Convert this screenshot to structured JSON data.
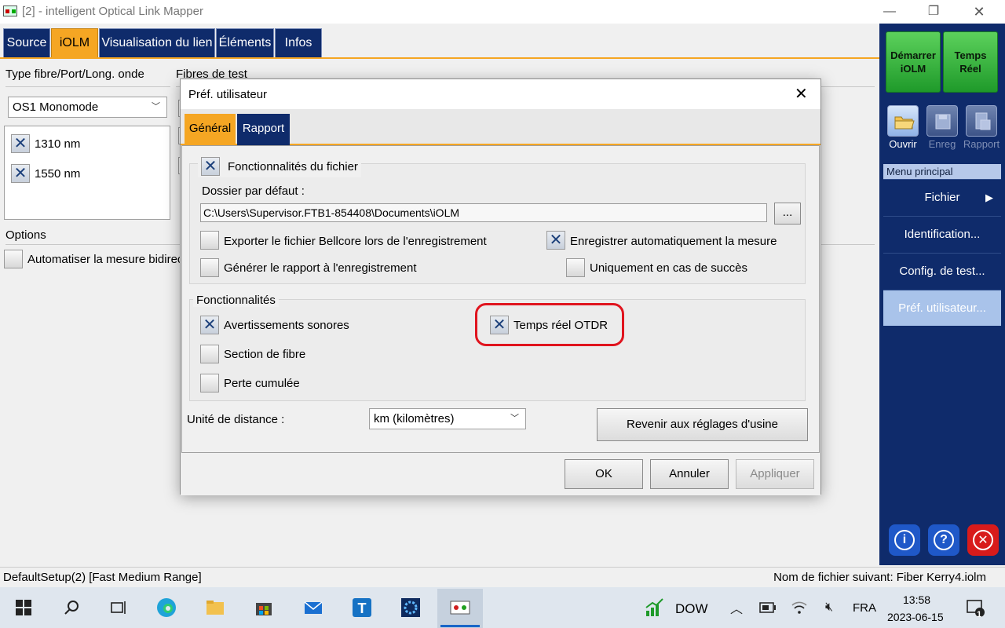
{
  "window": {
    "title": "[2] - intelligent Optical Link Mapper",
    "min_icon": "minimize-icon",
    "restore_icon": "restore-icon",
    "close_icon": "close-icon"
  },
  "tabs": [
    {
      "label": "Source"
    },
    {
      "label": "iOLM"
    },
    {
      "label": "Visualisation du lien"
    },
    {
      "label": "Éléments"
    },
    {
      "label": "Infos"
    }
  ],
  "left": {
    "fiber_type_label": "Type fibre/Port/Long. onde",
    "test_fibers_label": "Fibres de test",
    "fiber_select": "OS1 Monomode",
    "wavelengths": [
      {
        "label": "1310 nm",
        "checked": true
      },
      {
        "label": "1550 nm",
        "checked": true
      }
    ],
    "options_label": "Options",
    "auto_bidir_label": "Automatiser la mesure bidirec"
  },
  "right_panel": {
    "start_btn": "Démarrer iOLM",
    "realtime_btn": "Temps Réel",
    "tools": [
      {
        "label": "Ouvrir",
        "icon": "folder-open-icon"
      },
      {
        "label": "Enreg",
        "icon": "floppy-save-icon"
      },
      {
        "label": "Rapport",
        "icon": "report-icon"
      }
    ],
    "menu_header": "Menu principal",
    "menu_items": [
      {
        "label": "Fichier",
        "arrow": "▶"
      },
      {
        "label": "Identification..."
      },
      {
        "label": "Config. de test..."
      },
      {
        "label": "Préf. utilisateur..."
      }
    ],
    "info_icon": "i",
    "help_icon": "?",
    "exit_icon": "✕"
  },
  "status": {
    "left": "DefaultSetup(2) [Fast Medium Range]",
    "right": "Nom de fichier suivant: Fiber Kerry4.iolm"
  },
  "dialog": {
    "title": "Préf. utilisateur",
    "tabs": [
      {
        "label": "Général"
      },
      {
        "label": "Rapport"
      }
    ],
    "file_features_label": "Fonctionnalités du fichier",
    "default_folder_label": "Dossier par défaut :",
    "default_folder_value": "C:\\Users\\Supervisor.FTB1-854408\\Documents\\iOLM",
    "browse_label": "...",
    "export_bellcore": "Exporter le fichier Bellcore lors de l'enregistrement",
    "autosave": "Enregistrer automatiquement la mesure",
    "gen_report": "Générer le rapport à l'enregistrement",
    "only_success": "Uniquement en cas de succès",
    "features_label": "Fonctionnalités",
    "sound_alerts": "Avertissements sonores",
    "realtime_otdr": "Temps réel OTDR",
    "fiber_section": "Section de fibre",
    "cumulative_loss": "Perte cumulée",
    "distance_unit_label": "Unité de distance :",
    "distance_unit_value": "km (kilomètres)",
    "factory_reset": "Revenir aux réglages d'usine",
    "ok": "OK",
    "cancel": "Annuler",
    "apply": "Appliquer"
  },
  "taskbar": {
    "dow_label": "DOW",
    "lang": "FRA",
    "time": "13:58",
    "date": "2023-06-15",
    "notif_count": "1"
  }
}
